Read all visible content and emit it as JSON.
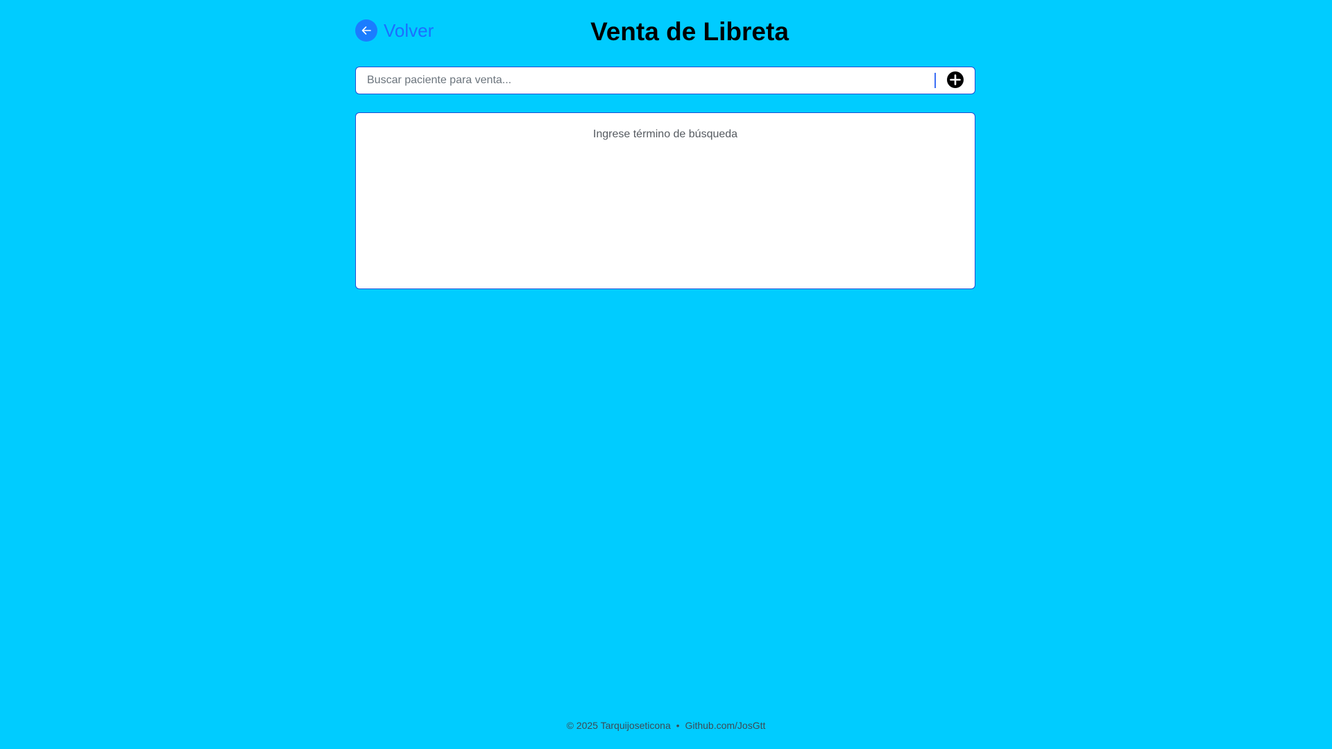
{
  "header": {
    "back_label": "Volver",
    "title": "Venta de Libreta"
  },
  "search": {
    "placeholder": "Buscar paciente para venta...",
    "value": ""
  },
  "results": {
    "empty_message": "Ingrese término de búsqueda"
  },
  "footer": {
    "copyright": "© 2025 Tarquijoseticona",
    "separator": "•",
    "link_text": "Github.com/JosGtt"
  },
  "icons": {
    "back": "arrow-left-icon",
    "add": "plus-circle-icon"
  },
  "colors": {
    "background": "#00ccff",
    "accent": "#1b7cff",
    "border": "#1a4fd6"
  }
}
